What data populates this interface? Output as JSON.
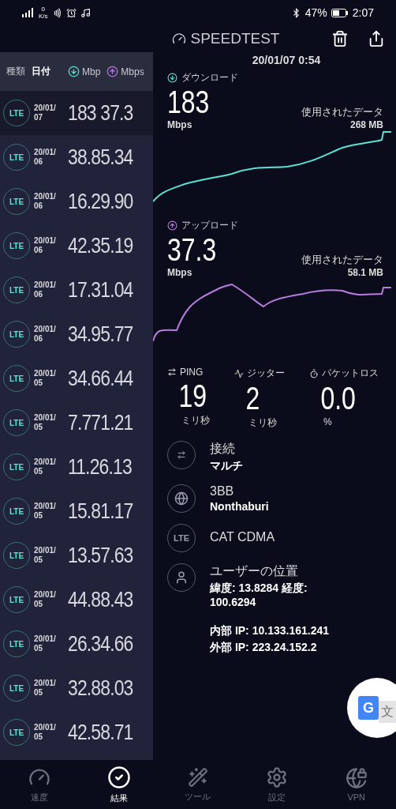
{
  "status_bar": {
    "speed": "0",
    "speed_unit": "K/s",
    "battery": "47%",
    "time": "2:07"
  },
  "header": {
    "title": "SPEEDTEST"
  },
  "history": {
    "columns": {
      "type": "種類",
      "date": "日付",
      "down": "Mbp",
      "up": "Mbps"
    },
    "rows": [
      {
        "type": "LTE",
        "date": "20/01/",
        "date2": "07",
        "value": "183 37.3",
        "selected": true
      },
      {
        "type": "LTE",
        "date": "20/01/",
        "date2": "06",
        "value": "38.85.34",
        "selected": false
      },
      {
        "type": "LTE",
        "date": "20/01/",
        "date2": "06",
        "value": "16.29.90",
        "selected": false
      },
      {
        "type": "LTE",
        "date": "20/01/",
        "date2": "06",
        "value": "42.35.19",
        "selected": false
      },
      {
        "type": "LTE",
        "date": "20/01/",
        "date2": "06",
        "value": "17.31.04",
        "selected": false
      },
      {
        "type": "LTE",
        "date": "20/01/",
        "date2": "06",
        "value": "34.95.77",
        "selected": false
      },
      {
        "type": "LTE",
        "date": "20/01/",
        "date2": "05",
        "value": "34.66.44",
        "selected": false
      },
      {
        "type": "LTE",
        "date": "20/01/",
        "date2": "05",
        "value": "7.771.21",
        "selected": false
      },
      {
        "type": "LTE",
        "date": "20/01/",
        "date2": "05",
        "value": "11.26.13",
        "selected": false
      },
      {
        "type": "LTE",
        "date": "20/01/",
        "date2": "05",
        "value": "15.81.17",
        "selected": false
      },
      {
        "type": "LTE",
        "date": "20/01/",
        "date2": "05",
        "value": "13.57.63",
        "selected": false
      },
      {
        "type": "LTE",
        "date": "20/01/",
        "date2": "05",
        "value": "44.88.43",
        "selected": false
      },
      {
        "type": "LTE",
        "date": "20/01/",
        "date2": "05",
        "value": "26.34.66",
        "selected": false
      },
      {
        "type": "LTE",
        "date": "20/01/",
        "date2": "05",
        "value": "32.88.03",
        "selected": false
      },
      {
        "type": "LTE",
        "date": "20/01/",
        "date2": "05",
        "value": "42.58.71",
        "selected": false
      }
    ]
  },
  "detail": {
    "timestamp": "20/01/07 0:54",
    "speeds": [
      {
        "kind": "download",
        "label": "ダウンロード",
        "value": "183",
        "unit": "Mbps",
        "data_label": "使用されたデータ",
        "data_value": "268 MB",
        "color": "#5ce0d2"
      },
      {
        "kind": "upload",
        "label": "アップロード",
        "value": "37.3",
        "unit": "Mbps",
        "data_label": "使用されたデータ",
        "data_value": "58.1 MB",
        "color": "#b97be0"
      }
    ],
    "metrics": [
      {
        "kind": "ping",
        "label": "PING",
        "value": "19",
        "unit": "ミリ秒"
      },
      {
        "kind": "jitter",
        "label": "ジッター",
        "value": "2",
        "unit": "ミリ秒"
      },
      {
        "kind": "loss",
        "label": "パケットロス",
        "value": "0.0",
        "unit": "%"
      }
    ],
    "info": [
      {
        "kind": "connection",
        "title": "接続",
        "subtitle": "マルチ"
      },
      {
        "kind": "provider",
        "title": "3BB",
        "subtitle": "Nonthaburi"
      },
      {
        "kind": "network",
        "badge": "LTE",
        "title": "CAT CDMA"
      },
      {
        "kind": "location",
        "title": "ユーザーの位置",
        "subtitle": "緯度: 13.8284 経度: 100.6294"
      }
    ],
    "ips": [
      "内部 IP: 10.133.161.241",
      "外部 IP: 223.24.152.2"
    ]
  },
  "translate_button": {
    "glyph": "G",
    "glyph2": "文"
  },
  "nav": [
    {
      "kind": "speed",
      "label": "速度",
      "selected": false
    },
    {
      "kind": "results",
      "label": "結果",
      "selected": true
    },
    {
      "kind": "tools",
      "label": "ツール",
      "selected": false
    },
    {
      "kind": "settings",
      "label": "設定",
      "selected": false
    },
    {
      "kind": "vpn",
      "label": "VPN",
      "selected": false
    }
  ]
}
